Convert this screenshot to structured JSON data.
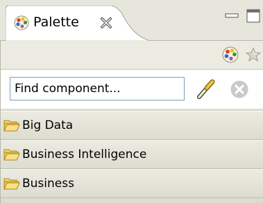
{
  "view": {
    "tab_title": "Palette",
    "tab_icon": "palette-icon",
    "close_icon": "close-x-icon",
    "minimize_icon": "minimize-icon",
    "maximize_icon": "maximize-icon"
  },
  "toolbar": {
    "palette_settings_icon": "palette-icon",
    "favorites_icon": "star-icon"
  },
  "search": {
    "value": "Find component...",
    "go_icon": "search-wand-icon",
    "clear_icon": "clear-circle-icon"
  },
  "drawers": [
    {
      "label": "Big Data",
      "icon": "folder-open-icon"
    },
    {
      "label": "Business Intelligence",
      "icon": "folder-open-icon"
    },
    {
      "label": "Business",
      "icon": "folder-open-icon"
    }
  ],
  "colors": {
    "panel_bg": "#ebebe2",
    "drawer_bg": "#e4e3d8",
    "input_border": "#7f9db9",
    "folder": "#f5c743"
  }
}
